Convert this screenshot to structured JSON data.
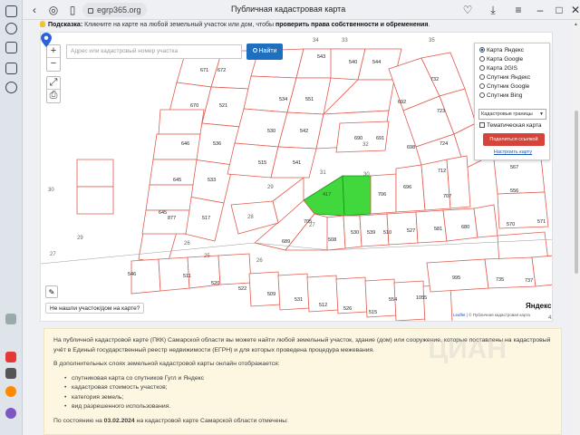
{
  "browser": {
    "url": "egrp365.org",
    "page_title": "Публичная кадастровая карта",
    "icons": [
      "back-icon",
      "shield-icon",
      "lock-icon",
      "favorite-icon",
      "download-icon",
      "menu-icon"
    ]
  },
  "hint": {
    "label": "Подсказка:",
    "text": "Кликните на карте на любой земельный участок или дом, чтобы",
    "strong": "проверить права собственности и обременения"
  },
  "map": {
    "search_placeholder": "Адрес или кадастровый номер участка",
    "find_label": "Найти",
    "not_found": "Не нашли участок/дом на карте?",
    "layers": {
      "options": [
        "Карта Яндекс",
        "Карта Google",
        "Карта 2GIS",
        "Спутник Яндекс",
        "Спутник Google",
        "Спутник Bing"
      ],
      "selected": "Карта Яндекс",
      "boundaries_select": "Кадастровые границы",
      "thematic_label": "Тематическая карта",
      "share_label": "Поделиться ссылкой",
      "configure_label": "Настроить карту"
    },
    "attribution_leaflet": "Leaflet",
    "attribution_text": "© Публичная кадастровая карта",
    "yandex_logo": "Яндекс",
    "accent_color": "#d5433b",
    "selected_parcel_color": "#40d83c"
  },
  "info": {
    "intro": "На публичной кадастровой карте (ПКК) Самарской области вы можете найти любой земельный участок, здание (дом) или сооружение, которые поставлены на кадастровый учёт в Единый государственный реестр недвижимости (ЕГРН) и для которых проведена процедура межевания.",
    "layers_intro": "В дополнительных слоях земельной кадастровой карты онлайн отображается:",
    "items": [
      "спутниковая карта со спутников Гугл и Яндекс",
      "кадастровая стоимость участков;",
      "категория земель;",
      "вид разрешенного использования."
    ],
    "status_prefix": "По состоянию на",
    "status_date": "03.02.2024",
    "status_suffix": "на кадастровой карте Самарской области отмечены:"
  }
}
